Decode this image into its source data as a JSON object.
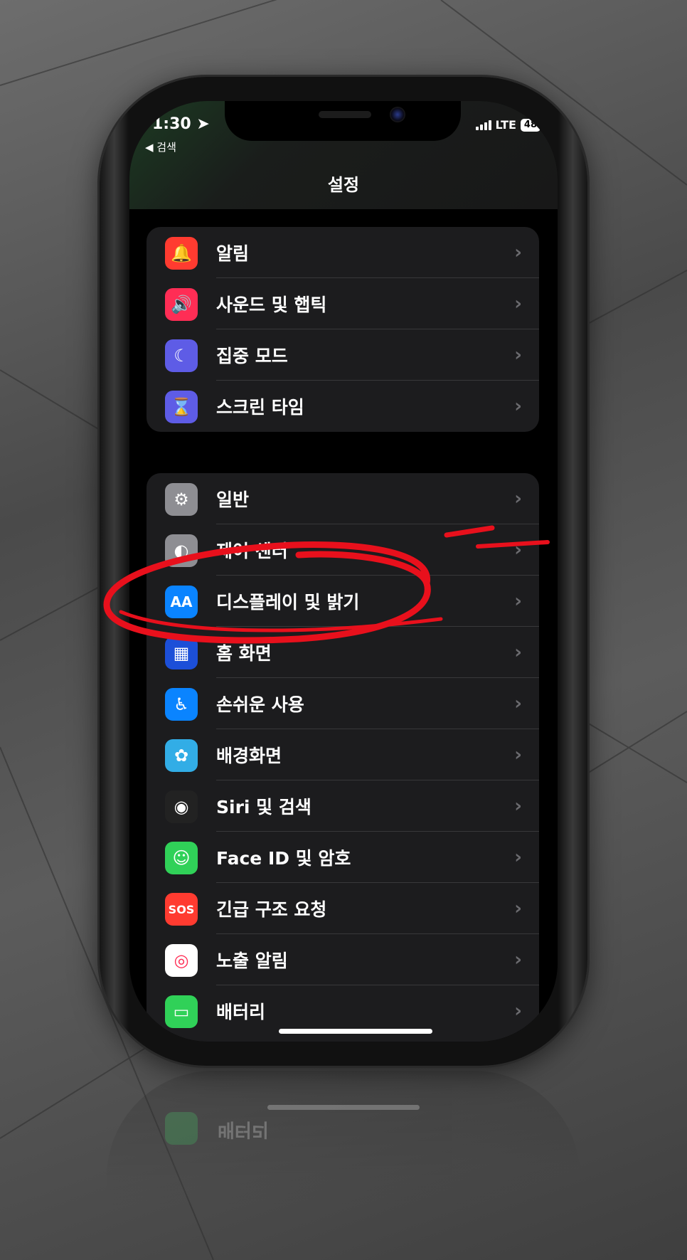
{
  "status_bar": {
    "time": "1:30",
    "back_label": "◀ 검색",
    "network": "LTE",
    "battery": "48"
  },
  "nav": {
    "title": "설정"
  },
  "group1": [
    {
      "label": "알림",
      "icon": "bell-icon",
      "color": "#ff3b30"
    },
    {
      "label": "사운드 및 햅틱",
      "icon": "speaker-icon",
      "color": "#ff2d55"
    },
    {
      "label": "집중 모드",
      "icon": "moon-icon",
      "color": "#5e5ce6"
    },
    {
      "label": "스크린 타임",
      "icon": "hourglass-icon",
      "color": "#5e5ce6"
    }
  ],
  "group2": [
    {
      "label": "일반",
      "icon": "gear-icon",
      "color": "#8e8e93"
    },
    {
      "label": "제어 센터",
      "icon": "toggle-icon",
      "color": "#8e8e93"
    },
    {
      "label": "디스플레이 및 밝기",
      "icon": "text-size-icon",
      "color": "#0a84ff",
      "icon_text": "AA"
    },
    {
      "label": "홈 화면",
      "icon": "home-grid-icon",
      "color": "#1c4fd8"
    },
    {
      "label": "손쉬운 사용",
      "icon": "accessibility-icon",
      "color": "#0a84ff"
    },
    {
      "label": "배경화면",
      "icon": "flower-icon",
      "color": "#32ade6"
    },
    {
      "label": "Siri 및 검색",
      "icon": "siri-icon",
      "color": "#222222"
    },
    {
      "label": "Face ID 및 암호",
      "icon": "face-id-icon",
      "color": "#30d158"
    },
    {
      "label": "긴급 구조 요청",
      "icon": "sos-icon",
      "color": "#ff3b30",
      "icon_text": "SOS"
    },
    {
      "label": "노출 알림",
      "icon": "exposure-icon",
      "color": "#ffffff"
    },
    {
      "label": "배터리",
      "icon": "battery-icon",
      "color": "#30d158"
    }
  ],
  "reflection": {
    "label": "배터리"
  },
  "annotation": {
    "color": "#e8101c"
  }
}
